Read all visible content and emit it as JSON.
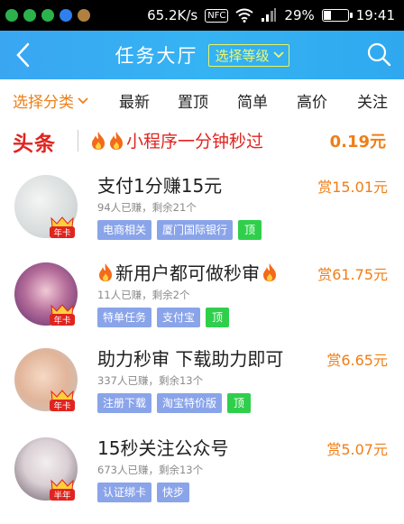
{
  "status_bar": {
    "speed": "65.2K/s",
    "nfc": "NFC",
    "battery": "29%",
    "battery_level": 0.29,
    "time": "19:41",
    "app_icon_colors": [
      "#2bb24c",
      "#2bb24c",
      "#2bb24c",
      "#2f80ed",
      "#b08040"
    ]
  },
  "header": {
    "title": "任务大厅",
    "level_button": "选择等级",
    "back_icon": "chevron-left-icon",
    "search_icon": "search-icon"
  },
  "tabs": [
    {
      "label": "选择分类",
      "active": true
    },
    {
      "label": "最新"
    },
    {
      "label": "置顶"
    },
    {
      "label": "简单"
    },
    {
      "label": "高价"
    },
    {
      "label": "关注"
    }
  ],
  "headline": {
    "label": "头条",
    "text": "小程序一分钟秒过",
    "price": "0.19元"
  },
  "tasks": [
    {
      "title": "支付1分赚15元",
      "meta": "94人已赚，剩余21个",
      "tags": [
        "电商相关",
        "厦门国际银行"
      ],
      "top_tag": "顶",
      "reward": "赏15.01元",
      "badge": "年卡",
      "fire": false
    },
    {
      "title": "新用户都可做秒审",
      "meta": "11人已赚，剩余2个",
      "tags": [
        "特单任务",
        "支付宝"
      ],
      "top_tag": "顶",
      "reward": "赏61.75元",
      "badge": "年卡",
      "fire": true
    },
    {
      "title": "助力秒审 下载助力即可",
      "meta": "337人已赚，剩余13个",
      "tags": [
        "注册下载",
        "淘宝特价版"
      ],
      "top_tag": "顶",
      "reward": "赏6.65元",
      "badge": "年卡",
      "fire": false
    },
    {
      "title": "15秒关注公众号",
      "meta": "673人已赚，剩余13个",
      "tags": [
        "认证绑卡",
        "快步"
      ],
      "top_tag": "",
      "reward": "赏5.07元",
      "badge": "半年",
      "fire": false
    }
  ],
  "colors": {
    "header_blue": "#35b3f3",
    "accent_orange": "#ef7e16",
    "headline_red": "#e0241f",
    "tag_blue": "#8aa4ea",
    "tag_green": "#2fcf4c"
  }
}
